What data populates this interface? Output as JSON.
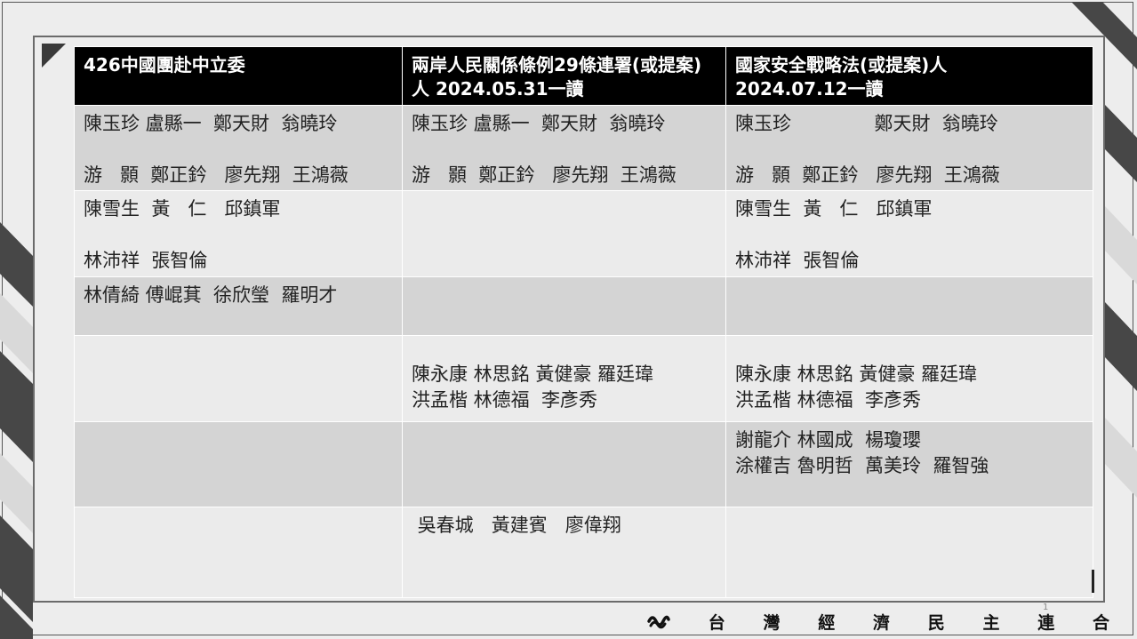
{
  "table": {
    "headers": [
      "426中國團赴中立委",
      "兩岸人民關係條例29條連署(或提案)人  2024.05.31一讀",
      "國家安全戰略法(或提案)人\n2024.07.12一讀"
    ],
    "rows": [
      [
        "陳玉珍 盧縣一  鄭天財  翁曉玲\n\n游   顥  鄭正鈐   廖先翔  王鴻薇",
        "陳玉珍 盧縣一  鄭天財  翁曉玲\n\n游   顥  鄭正鈐   廖先翔  王鴻薇",
        "陳玉珍              鄭天財  翁曉玲\n\n游   顥  鄭正鈐   廖先翔  王鴻薇"
      ],
      [
        "陳雪生  黃   仁   邱鎮軍\n\n林沛祥  張智倫",
        "",
        "陳雪生  黃   仁   邱鎮軍\n\n林沛祥  張智倫"
      ],
      [
        "林倩綺 傅崐萁  徐欣瑩  羅明才",
        "",
        ""
      ],
      [
        "",
        "\n陳永康 林思銘 黃健豪 羅廷瑋\n洪孟楷 林德福  李彥秀",
        "\n陳永康 林思銘 黃健豪 羅廷瑋\n洪孟楷 林德福  李彥秀"
      ],
      [
        "",
        "",
        "謝龍介 林國成  楊瓊瓔\n涂權吉 魯明哲  萬美玲  羅智強"
      ],
      [
        "",
        " 吳春城   黃建賓   廖偉翔",
        ""
      ]
    ]
  },
  "footer": {
    "chars": [
      "台",
      "灣",
      "經",
      "濟",
      "民",
      "主",
      "連",
      "合"
    ],
    "logo_icon": "wave-logo-icon"
  },
  "page_number": "1"
}
